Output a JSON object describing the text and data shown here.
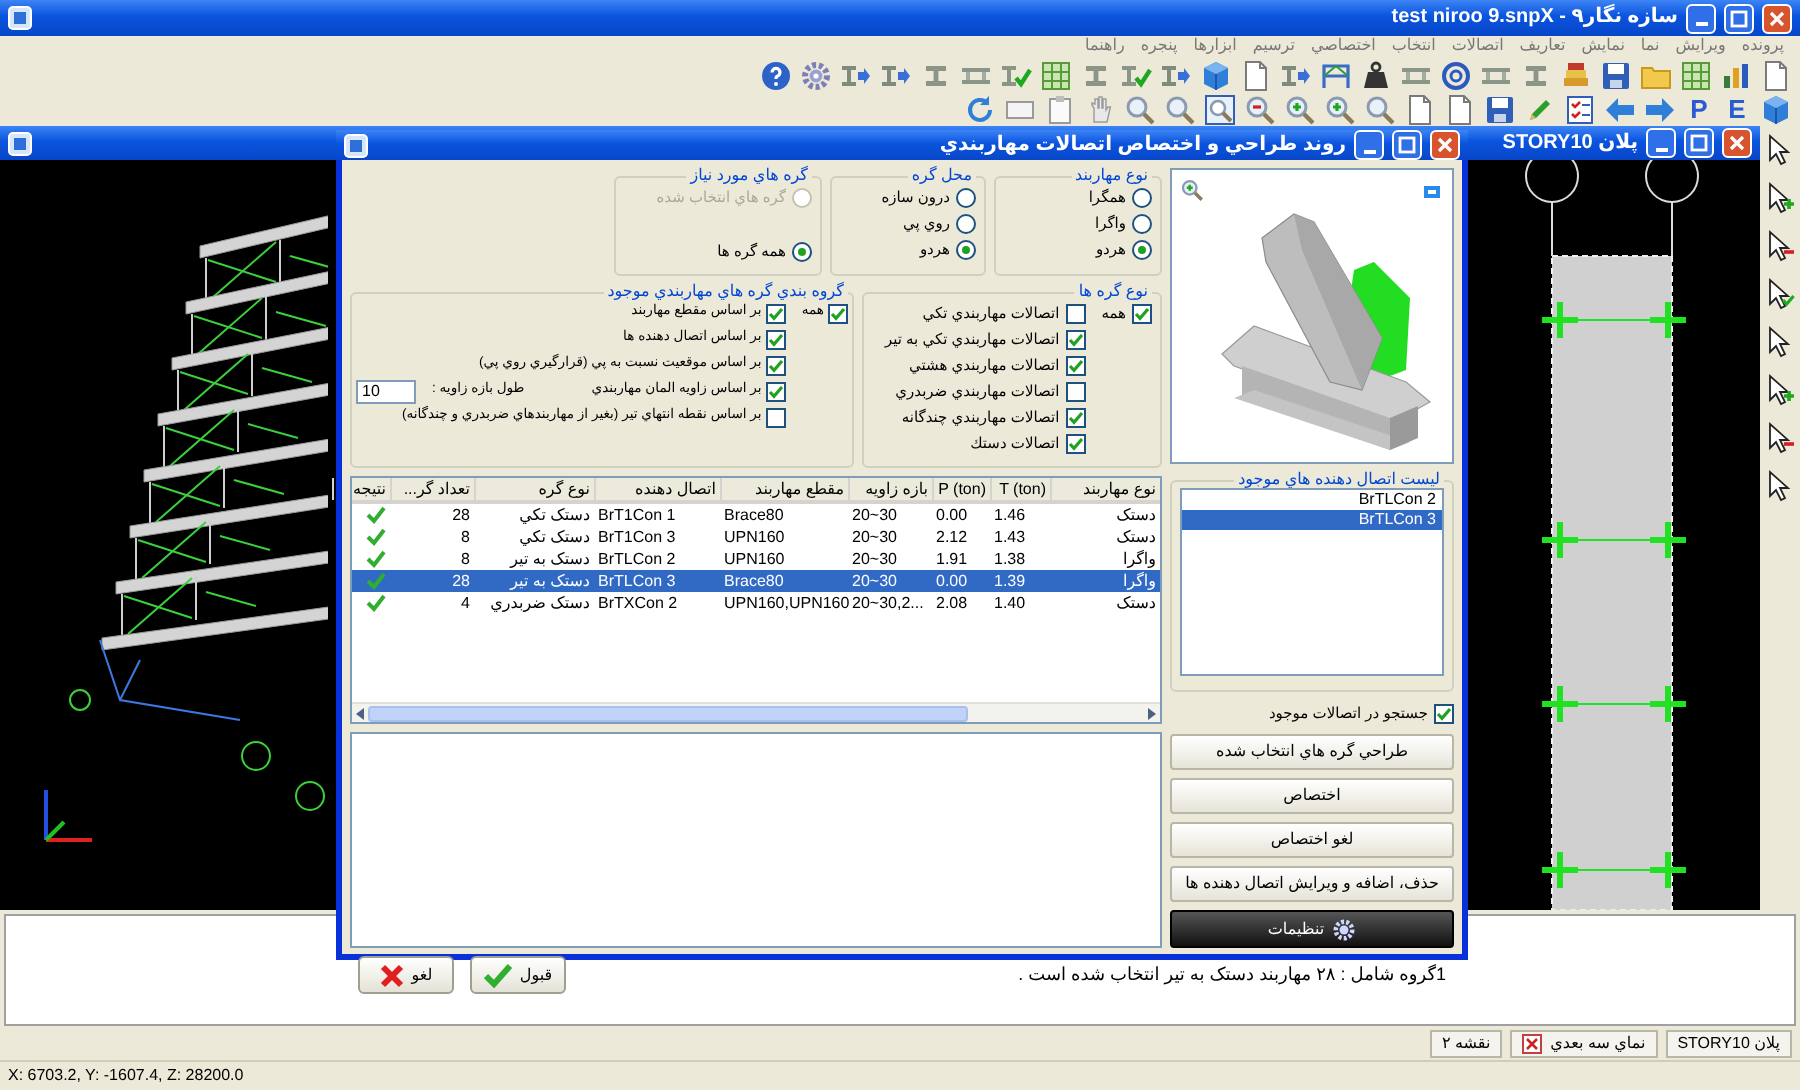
{
  "window": {
    "title": "سازه نگار۹ - test niroo 9.snpX"
  },
  "menu": [
    "پرونده",
    "ويرايش",
    "نما",
    "نمايش",
    "تعاريف",
    "اتصالات",
    "انتخاب",
    "اختصاصي",
    "ترسيم",
    "ابزارها",
    "پنجره",
    "راهنما"
  ],
  "toolbar_letters": [
    "E",
    "P"
  ],
  "plan_window": {
    "title": "پلان STORY10"
  },
  "dialog": {
    "title": "روند طراحي و اختصاص اتصالات مهاربندي",
    "brace_type": {
      "title": "نوع مهاربند",
      "options": [
        {
          "label": "همگرا",
          "selected": false,
          "disabled": false
        },
        {
          "label": "واگرا",
          "selected": false,
          "disabled": false
        },
        {
          "label": "هردو",
          "selected": true,
          "disabled": false
        }
      ]
    },
    "node_location": {
      "title": "محل گره",
      "options": [
        {
          "label": "درون سازه",
          "selected": false,
          "disabled": false
        },
        {
          "label": "روي پي",
          "selected": false,
          "disabled": false
        },
        {
          "label": "هردو",
          "selected": true,
          "disabled": false
        }
      ]
    },
    "required_nodes": {
      "title": "گره هاي مورد نياز",
      "options": [
        {
          "label": "گره هاي انتخاب شده",
          "selected": false,
          "disabled": true
        },
        {
          "label": "همه گره ها",
          "selected": true,
          "disabled": false
        }
      ]
    },
    "node_types": {
      "title": "نوع گره ها",
      "all": {
        "label": "همه",
        "checked": true
      },
      "items": [
        {
          "label": "اتصالات مهاربندي تكي",
          "checked": false
        },
        {
          "label": "اتصالات مهاربندي تكي به تير",
          "checked": true
        },
        {
          "label": "اتصالات مهاربندي هشتي",
          "checked": true
        },
        {
          "label": "اتصالات مهاربندي ضربدري",
          "checked": false
        },
        {
          "label": "اتصالات مهاربندي چندگانه",
          "checked": true
        },
        {
          "label": "اتصالات دستك",
          "checked": true
        }
      ]
    },
    "grouping": {
      "title": "گروه بندي گره هاي مهاربندي موجود",
      "all": {
        "label": "همه",
        "checked": true
      },
      "items": [
        {
          "label": "بر اساس مقطع مهاربند",
          "checked": true
        },
        {
          "label": "بر اساس اتصال دهنده ها",
          "checked": true
        },
        {
          "label": "بر اساس موقعيت نسبت به پي (قرارگيري روي پي)",
          "checked": true
        },
        {
          "label": "بر اساس زاويه المان مهاربندي",
          "checked": true,
          "angle_range": {
            "label": "طول بازه زاويه :",
            "value": "10"
          }
        },
        {
          "label": "بر اساس نقطه انتهاي تير (بغير از مهاربندهاي ضربدري و چندگانه)",
          "checked": false
        }
      ]
    },
    "table": {
      "columns": [
        "نوع مهاربند",
        "T (ton)",
        "P (ton)",
        "بازه زاويه",
        "مقطع مهاربند",
        "اتصال دهنده",
        "نوع گره",
        "تعداد گر...",
        "نتيجه"
      ],
      "rows": [
        {
          "cells": [
            "دستک",
            "1.46",
            "0.00",
            "20~30",
            "Brace80",
            "BrT1Con 1",
            "دستک تکي",
            "28"
          ],
          "passed": true,
          "selected": false
        },
        {
          "cells": [
            "دستک",
            "1.43",
            "2.12",
            "20~30",
            "UPN160",
            "BrT1Con 3",
            "دستک تکي",
            "8"
          ],
          "passed": true,
          "selected": false
        },
        {
          "cells": [
            "واگرا",
            "1.38",
            "1.91",
            "20~30",
            "UPN160",
            "BrTLCon 2",
            "دستک به تير",
            "8"
          ],
          "passed": true,
          "selected": false
        },
        {
          "cells": [
            "واگرا",
            "1.39",
            "0.00",
            "20~30",
            "Brace80",
            "BrTLCon 3",
            "دستک به تير",
            "28"
          ],
          "passed": true,
          "selected": true
        },
        {
          "cells": [
            "دستک",
            "1.40",
            "2.08",
            "20~30,2...",
            "UPN160,UPN160",
            "BrTXCon 2",
            "دستک ضربدري",
            "4"
          ],
          "passed": true,
          "selected": false
        }
      ]
    },
    "connectors": {
      "title": "ليست اتصال دهنده هاي موجود",
      "items": [
        {
          "label": "BrTLCon 2",
          "selected": false
        },
        {
          "label": "BrTLCon 3",
          "selected": true
        }
      ]
    },
    "search_existing": {
      "label": "جستجو در اتصالات موجود",
      "checked": true
    },
    "actions": [
      "طراحي گره هاي انتخاب شده",
      "اختصاص",
      "لغو اختصاص",
      "حذف، اضافه و ويرايش اتصال دهنده ها"
    ],
    "settings_button": "تنظيمات",
    "message": "1گروه شامل : ۲۸ مهاربند  دستک به تير انتخاب شده است .",
    "ok_button": "قبول",
    "cancel_button": "لغو"
  },
  "document_tabs": [
    {
      "label": "پلان STORY10",
      "closable": false
    },
    {
      "label": "نماي سه بعدي",
      "closable": true
    },
    {
      "label": "نقشه ۲",
      "closable": false
    }
  ],
  "status_bar": "X: 6703.2, Y: -1607.4, Z: 28200.0"
}
